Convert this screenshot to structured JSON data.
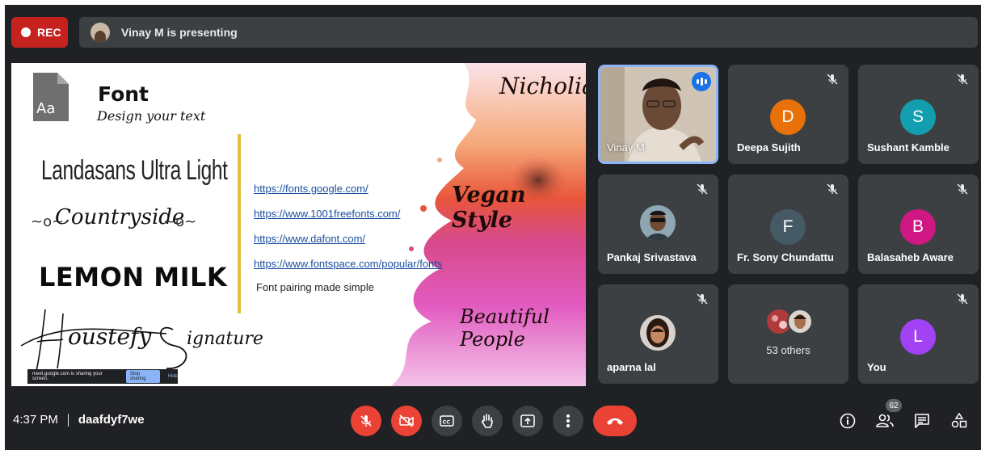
{
  "top_bar": {
    "rec_label": "REC",
    "presenting_text": "Vinay M is presenting"
  },
  "slide": {
    "font_title": "Font",
    "font_subtitle": "Design your text",
    "doc_icon_text": "Aa",
    "sample_fonts": [
      "Landasans Ultra Light",
      "Countryside",
      "LEMON MILK",
      "Houstefy Signature"
    ],
    "countryside_left": "~o~",
    "countryside_right": "~o~",
    "links": [
      "https://fonts.google.com/",
      "https://www.1001freefonts.com/",
      "https://www.dafont.com/",
      "https://www.fontspace.com/popular/fonts"
    ],
    "pairing_text": "Font pairing made simple",
    "script_samples": [
      "Nicholia",
      "Vegan Style",
      "Beautiful People"
    ],
    "share_notice": {
      "text": "meet.google.com is sharing your screen.",
      "stop_label": "Stop sharing",
      "hide_label": "Hide"
    }
  },
  "participants": [
    {
      "name": "Vinay M",
      "type": "video",
      "speaking": true
    },
    {
      "name": "Deepa Sujith",
      "initial": "D",
      "color": "#e8710a",
      "muted": true
    },
    {
      "name": "Sushant Kamble",
      "initial": "S",
      "color": "#129eaf",
      "muted": true
    },
    {
      "name": "Pankaj Srivastava",
      "type": "photo",
      "muted": true
    },
    {
      "name": "Fr. Sony Chundattu",
      "initial": "F",
      "color": "#455a64",
      "muted": true
    },
    {
      "name": "Balasaheb Aware",
      "initial": "B",
      "color": "#d01884",
      "muted": true
    },
    {
      "name": "aparna lal",
      "type": "photo",
      "muted": true
    },
    {
      "name": "53 others",
      "type": "group"
    },
    {
      "name": "You",
      "initial": "L",
      "color": "#a142f4",
      "muted": true
    }
  ],
  "bottom_bar": {
    "time": "4:37 PM",
    "meeting_code": "daafdyf7we",
    "controls": [
      "mic-off-icon",
      "camera-off-icon",
      "captions-icon",
      "raise-hand-icon",
      "present-icon",
      "more-options-icon",
      "end-call-icon"
    ],
    "right_icons": [
      "info-icon",
      "people-icon",
      "chat-icon",
      "activities-icon"
    ],
    "people_count": "62"
  },
  "colors": {
    "background": "#202124",
    "tile": "#3c4043",
    "danger": "#ea4335",
    "active_speaker": "#8ab4f8"
  }
}
